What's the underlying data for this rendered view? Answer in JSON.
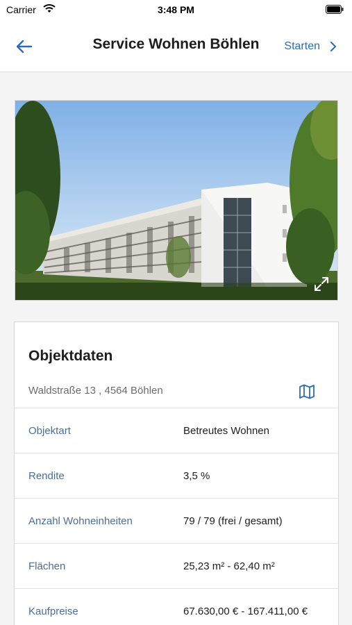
{
  "status_bar": {
    "carrier": "Carrier",
    "time": "3:48 PM"
  },
  "nav": {
    "title": "Service Wohnen Böhlen",
    "start_label": "Starten",
    "back_icon": "arrow-left-icon",
    "forward_icon": "chevron-right-icon"
  },
  "hero": {
    "expand_icon": "expand-icon"
  },
  "card": {
    "title": "Objektdaten",
    "address": "Waldstraße 13 , 4564 Böhlen",
    "map_icon": "map-icon",
    "rows": [
      {
        "label": "Objektart",
        "value": "Betreutes Wohnen"
      },
      {
        "label": "Rendite",
        "value": "3,5 %"
      },
      {
        "label": "Anzahl Wohneinheiten",
        "value": "79 / 79 (frei / gesamt)"
      },
      {
        "label": "Flächen",
        "value": "25,23 m² - 62,40 m²"
      },
      {
        "label": "Kaufpreise",
        "value": "67.630,00 € - 167.411,00 €"
      }
    ]
  },
  "colors": {
    "accent": "#2b6cb8",
    "label": "#4a6e9a"
  }
}
